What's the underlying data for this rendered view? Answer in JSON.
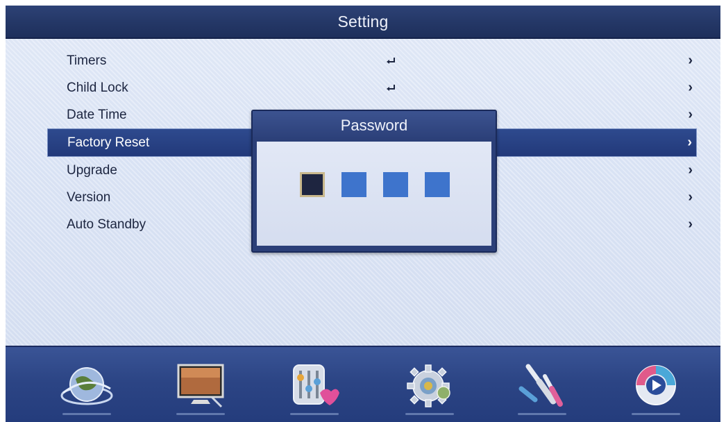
{
  "header": {
    "title": "Setting"
  },
  "menu": {
    "items": [
      {
        "label": "Timers",
        "has_enter": true,
        "arrow": "›"
      },
      {
        "label": "Child Lock",
        "has_enter": true,
        "arrow": "›"
      },
      {
        "label": "Date Time",
        "has_enter": false,
        "arrow": "›"
      },
      {
        "label": "Factory Reset",
        "has_enter": false,
        "arrow": "›",
        "selected": true
      },
      {
        "label": "Upgrade",
        "has_enter": false,
        "arrow": "›"
      },
      {
        "label": "Version",
        "has_enter": false,
        "arrow": "›"
      },
      {
        "label": "Auto Standby",
        "has_enter": false,
        "arrow": "›"
      }
    ]
  },
  "password_dialog": {
    "title": "Password",
    "digits_total": 4,
    "digits_entered": 0,
    "active_index": 0
  },
  "dock": {
    "icons": [
      "globe-icon",
      "tv-picture-icon",
      "sound-equalizer-icon",
      "settings-gear-icon",
      "av-cable-icon",
      "media-play-icon"
    ],
    "active_icon": "settings-gear-icon"
  },
  "colors": {
    "title_bar": "#243766",
    "selection": "#22397a",
    "password_box": "#3e74cc",
    "password_box_active": "#1e2540"
  }
}
